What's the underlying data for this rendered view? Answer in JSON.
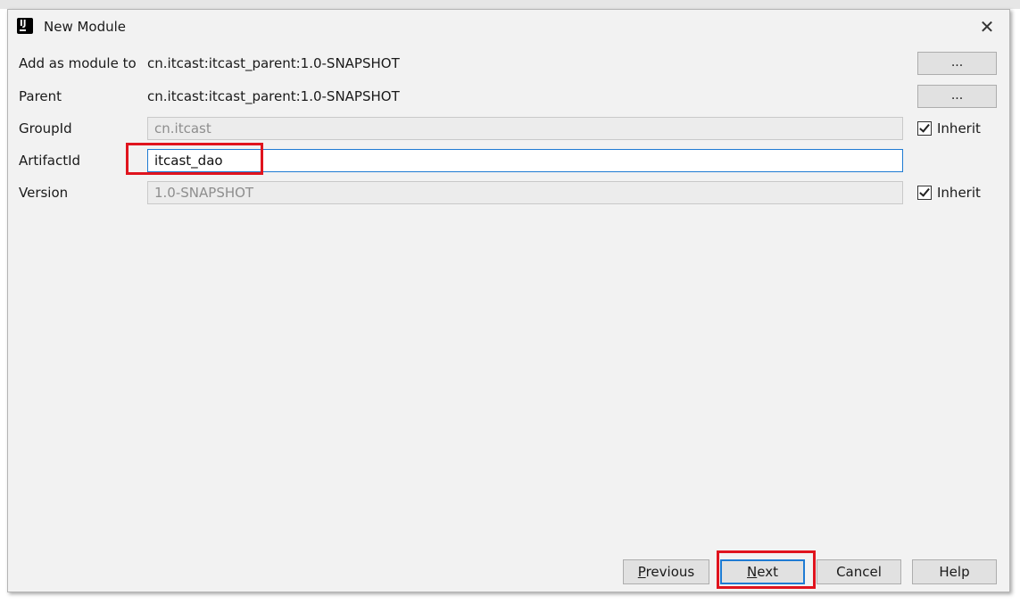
{
  "dialog": {
    "title": "New Module",
    "close_glyph": "✕",
    "icon": "intellij-idea-icon"
  },
  "form": {
    "add_as_module": {
      "label": "Add as module to",
      "value": "cn.itcast:itcast_parent:1.0-SNAPSHOT",
      "button": "..."
    },
    "parent": {
      "label": "Parent",
      "value": "cn.itcast:itcast_parent:1.0-SNAPSHOT",
      "button": "..."
    },
    "group_id": {
      "label": "GroupId",
      "value": "cn.itcast",
      "inherit_label": "Inherit",
      "inherit_checked": true
    },
    "artifact_id": {
      "label": "ArtifactId",
      "value": "itcast_dao"
    },
    "version": {
      "label": "Version",
      "value": "1.0-SNAPSHOT",
      "inherit_label": "Inherit",
      "inherit_checked": true
    }
  },
  "buttons": {
    "previous_first": "P",
    "previous_rest": "revious",
    "next_first": "N",
    "next_rest": "ext",
    "cancel": "Cancel",
    "help": "Help"
  },
  "colors": {
    "highlight": "#e0141e",
    "focus": "#1f7bd3"
  }
}
